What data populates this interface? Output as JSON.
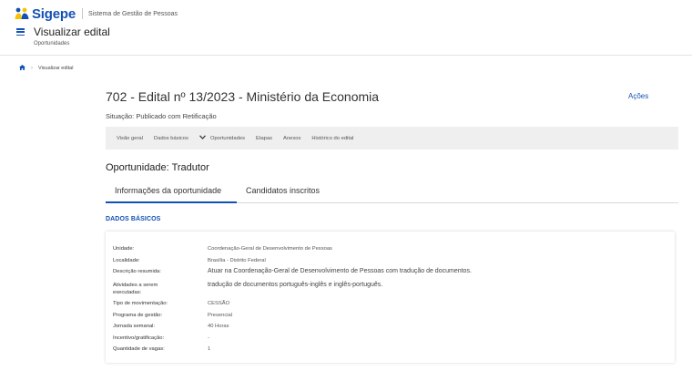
{
  "brand": {
    "name": "Sigepe",
    "subtitle": "Sistema de Gestão de Pessoas"
  },
  "header": {
    "title": "Visualizar edital",
    "subtitle": "Oportunidades"
  },
  "breadcrumb": {
    "current": "Visualizar edital"
  },
  "edital": {
    "title": "702 - Edital nº 13/2023 - Ministério da Economia",
    "actions_label": "Ações",
    "status": "Situação: Publicado com Retificação"
  },
  "nav_tabs": [
    {
      "label": "Visão geral"
    },
    {
      "label": "Dados básicos"
    },
    {
      "label": "Oportunidades"
    },
    {
      "label": "Etapas"
    },
    {
      "label": "Anexos"
    },
    {
      "label": "Histórico do edital"
    }
  ],
  "opportunity": {
    "title": "Oportunidade: Tradutor",
    "tabs": [
      {
        "label": "Informações da oportunidade"
      },
      {
        "label": "Candidatos inscritos"
      }
    ],
    "section_title": "DADOS BÁSICOS",
    "fields": [
      {
        "label": "Unidade:",
        "value": "Coordenação-Geral de Desenvolvimento de Pessoas"
      },
      {
        "label": "Localidade:",
        "value": "Brasília - Distrito Federal"
      },
      {
        "label": "Descrição resumida:",
        "value": "Atuar na Coordenação-Geral de Desenvolvimento de Pessoas com tradução de documentos."
      },
      {
        "label": "Atividades a serem executadas:",
        "value": "tradução de documentos português-inglês e inglês-português."
      },
      {
        "label": "Tipo de movimentação:",
        "value": "CESSÃO"
      },
      {
        "label": "Programa de gestão:",
        "value": "Presencial"
      },
      {
        "label": "Jornada semanal:",
        "value": "40 Horas"
      },
      {
        "label": "Incentivo/gratificação:",
        "value": "-"
      },
      {
        "label": "Quantidade de vagas:",
        "value": "1"
      }
    ]
  },
  "colors": {
    "primary": "#1351b4",
    "logo_yellow": "#f5c400",
    "tabbar_bg": "#efefef"
  }
}
